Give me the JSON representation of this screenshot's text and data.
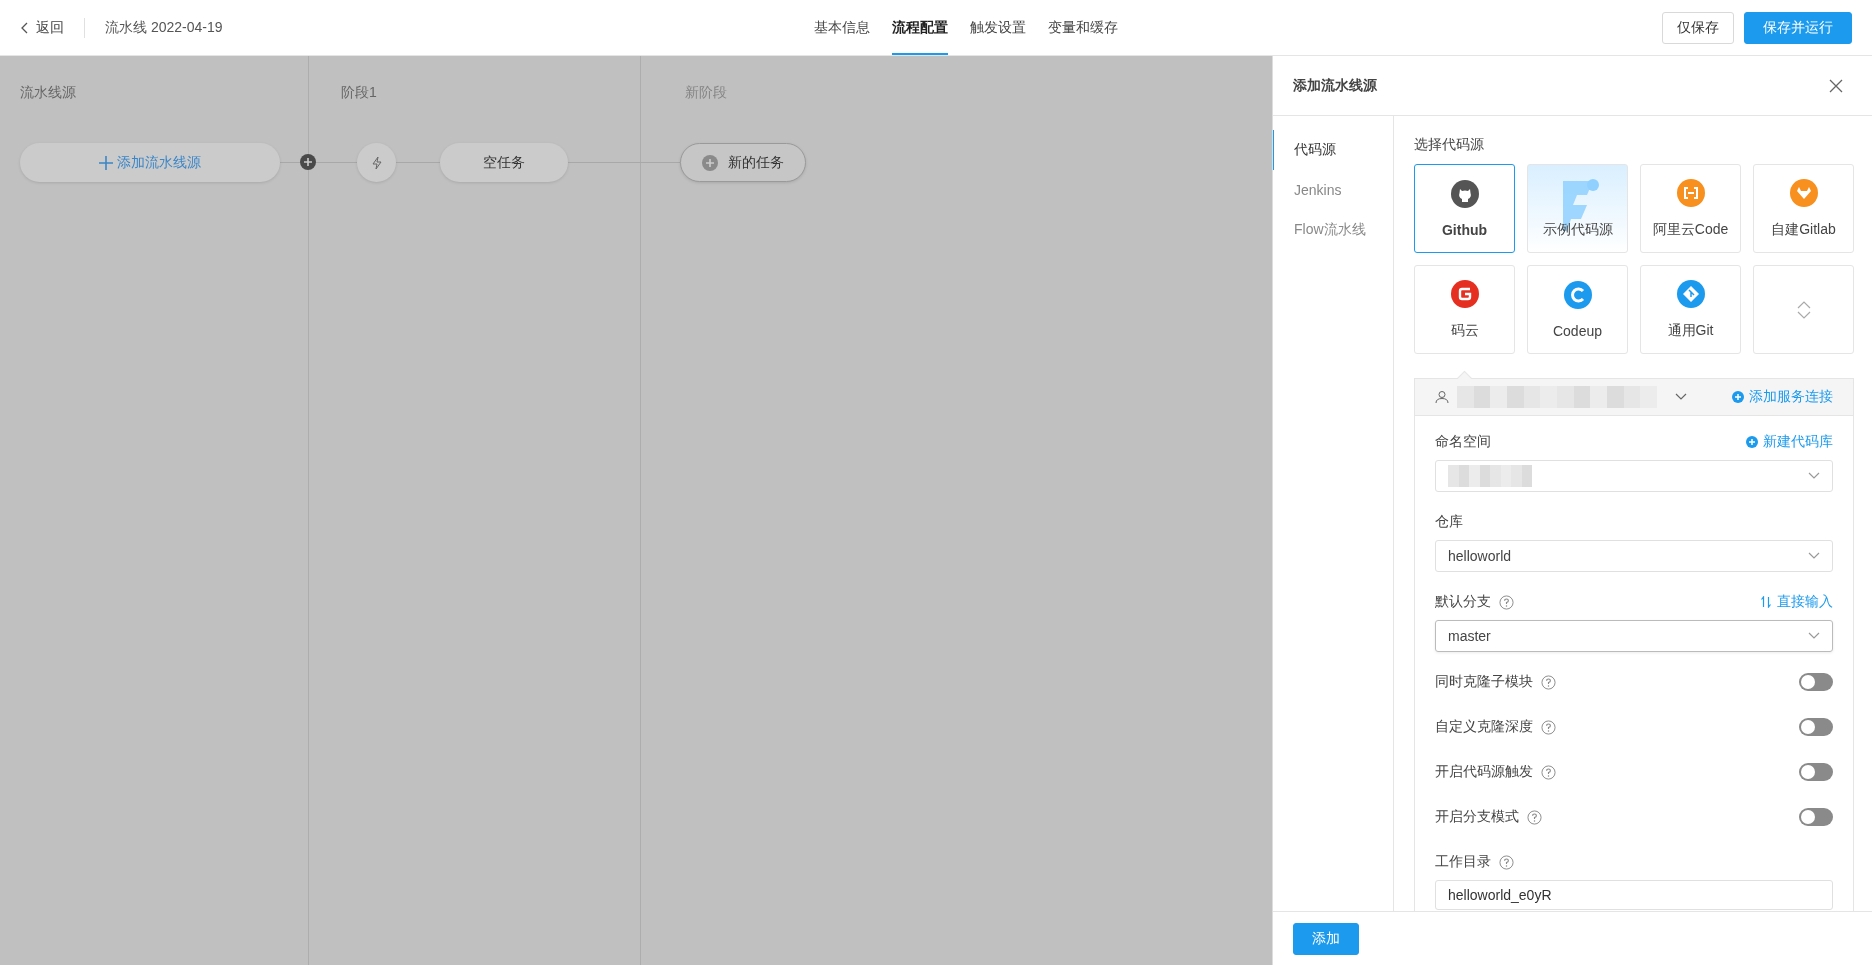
{
  "header": {
    "back": "返回",
    "title": "流水线 2022-04-19",
    "tabs": [
      {
        "label": "基本信息",
        "selected": false
      },
      {
        "label": "流程配置",
        "selected": true
      },
      {
        "label": "触发设置",
        "selected": false
      },
      {
        "label": "变量和缓存",
        "selected": false
      }
    ],
    "buttons": [
      {
        "label": "仅保存",
        "kind": "default"
      },
      {
        "label": "保存并运行",
        "kind": "primary"
      }
    ]
  },
  "pipeline": {
    "stages": [
      {
        "title": "流水线源",
        "muted": false
      },
      {
        "title": "阶段1",
        "muted": false
      },
      {
        "title": "新阶段",
        "muted": true
      }
    ],
    "add_source": "添加流水线源",
    "task": "空任务",
    "new_task": "新的任务"
  },
  "drawer": {
    "title": "添加流水线源",
    "nav": [
      {
        "label": "代码源",
        "selected": true
      },
      {
        "label": "Jenkins",
        "selected": false
      },
      {
        "label": "Flow流水线",
        "selected": false
      }
    ],
    "section_label": "选择代码源",
    "sources": [
      {
        "kind": "github",
        "label": "Github",
        "selected": true,
        "color": "#555555"
      },
      {
        "kind": "sample",
        "label": "示例代码源",
        "selected": false,
        "color": "#8fd0ff"
      },
      {
        "kind": "aliyun",
        "label": "阿里云Code",
        "selected": false,
        "color": "#f7901e"
      },
      {
        "kind": "gitlab",
        "label": "自建Gitlab",
        "selected": false,
        "color": "#f7901e"
      },
      {
        "kind": "gitee",
        "label": "码云",
        "selected": false,
        "color": "#e52f21"
      },
      {
        "kind": "codeup",
        "label": "Codeup",
        "selected": false,
        "color": "#1b9aee"
      },
      {
        "kind": "git",
        "label": "通用Git",
        "selected": false,
        "color": "#1b9aee"
      },
      {
        "kind": "expand",
        "selected": false
      }
    ],
    "connection": {
      "account_redacted": true,
      "link": "添加服务连接"
    },
    "fields": [
      {
        "kind": "select",
        "label": "命名空间",
        "help": false,
        "value_redacted": true,
        "link": {
          "kind": "plus",
          "text": "新建代码库"
        },
        "focused": false
      },
      {
        "kind": "select",
        "label": "仓库",
        "help": false,
        "value": "helloworld",
        "focused": false
      },
      {
        "kind": "select",
        "label": "默认分支",
        "help": true,
        "value": "master",
        "link": {
          "kind": "swap",
          "text": "直接输入"
        },
        "focused": true
      },
      {
        "kind": "toggle",
        "label": "同时克隆子模块",
        "help": true,
        "on": false
      },
      {
        "kind": "toggle",
        "label": "自定义克隆深度",
        "help": true,
        "on": false
      },
      {
        "kind": "toggle",
        "label": "开启代码源触发",
        "help": true,
        "on": false
      },
      {
        "kind": "toggle",
        "label": "开启分支模式",
        "help": true,
        "on": false
      },
      {
        "kind": "input",
        "label": "工作目录",
        "help": true,
        "value": "helloworld_e0yR"
      }
    ],
    "submit": "添加"
  }
}
